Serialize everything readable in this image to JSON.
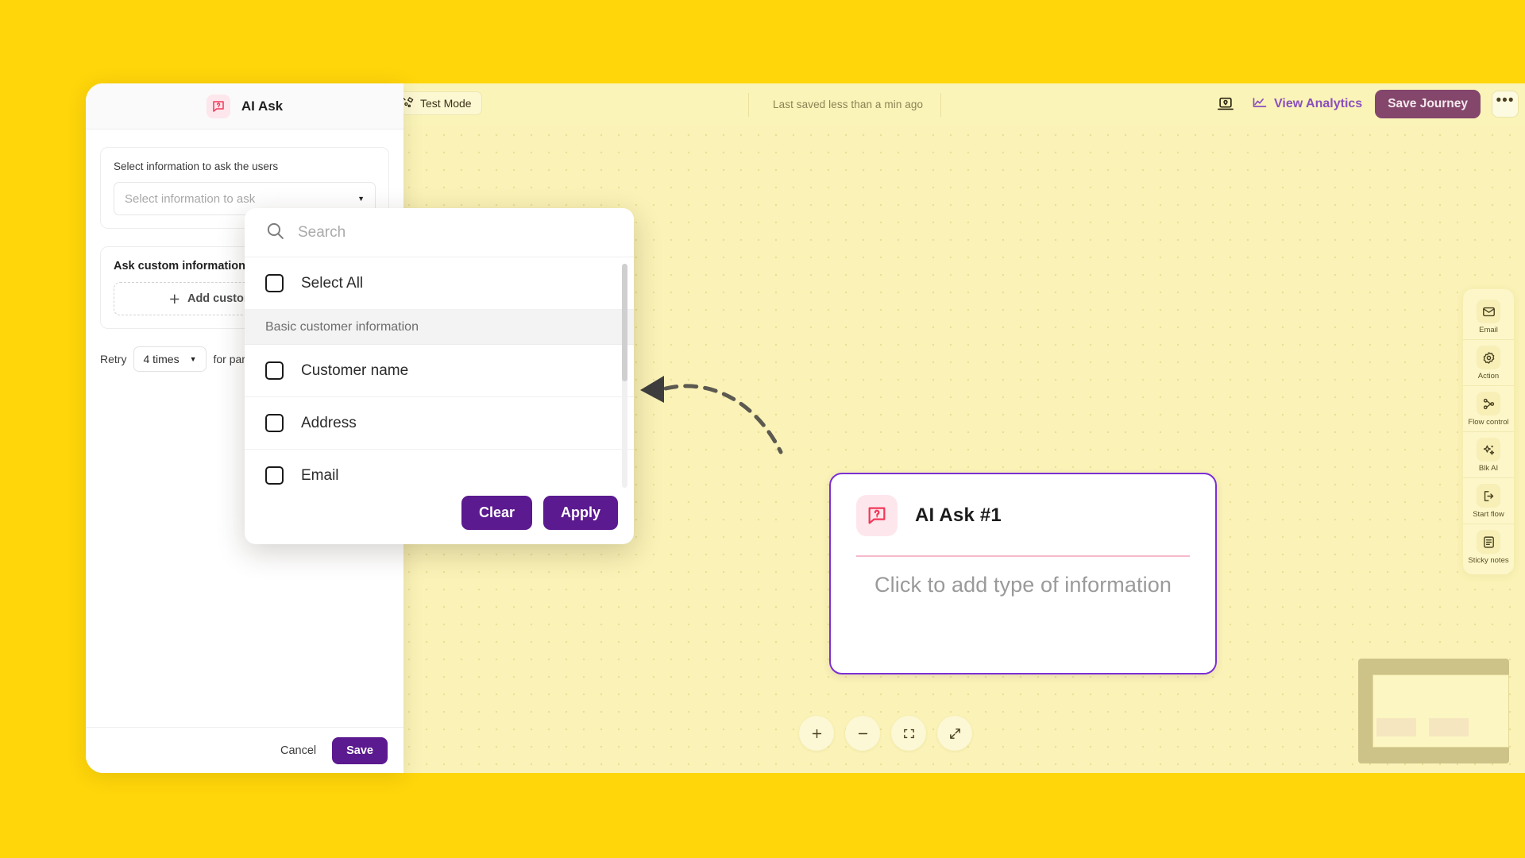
{
  "topbar": {
    "test_mode_label": "Test Mode",
    "test_mode_icon": "test-flask-icon",
    "saved_status": "Last saved less than a min ago",
    "laptop_icon": "laptop-preview-icon",
    "analytics_icon": "line-chart-icon",
    "analytics_label": "View Analytics",
    "save_journey_label": "Save Journey",
    "more_label": "•••",
    "accent_purple": "#8B4FBF",
    "save_journey_bg": "#84476B"
  },
  "panel": {
    "title": "AI Ask",
    "icon": "ai-ask-chat-question-icon",
    "select_card": {
      "label": "Select information to ask the users",
      "placeholder": "Select information to ask",
      "caret_icon": "chevron-down-icon"
    },
    "custom_card": {
      "title": "Ask custom information",
      "add_label": "Add custom information",
      "add_icon": "plus-icon"
    },
    "retry": {
      "prefix": "Retry",
      "value": "4 times",
      "suffix": "for partial",
      "caret_icon": "chevron-down-icon"
    },
    "footer": {
      "cancel_label": "Cancel",
      "save_label": "Save",
      "save_bg": "#5B1A8F"
    }
  },
  "dropdown": {
    "search_placeholder": "Search",
    "search_value": "",
    "search_icon": "search-icon",
    "rows": [
      {
        "kind": "option",
        "label": "Select All",
        "checked": false
      },
      {
        "kind": "group",
        "label": "Basic customer information"
      },
      {
        "kind": "option",
        "label": "Customer name",
        "checked": false
      },
      {
        "kind": "option",
        "label": "Address",
        "checked": false
      },
      {
        "kind": "option",
        "label": "Email",
        "checked": false
      }
    ],
    "clear_label": "Clear",
    "apply_label": "Apply",
    "button_bg": "#5B1A8F"
  },
  "node": {
    "icon": "ai-ask-chat-question-icon",
    "title": "AI Ask #1",
    "placeholder": "Click to add type of information",
    "border_color": "#7B2FD4"
  },
  "tool_rail": {
    "items": [
      {
        "icon": "envelope-icon",
        "label": "Email"
      },
      {
        "icon": "gear-icon",
        "label": "Action"
      },
      {
        "icon": "branch-icon",
        "label": "Flow control"
      },
      {
        "icon": "sparkles-icon",
        "label": "Blk AI"
      },
      {
        "icon": "start-flow-icon",
        "label": "Start flow"
      },
      {
        "icon": "sticky-note-icon",
        "label": "Sticky notes"
      }
    ]
  },
  "zoom_controls": [
    {
      "icon": "plus-icon",
      "label": "+"
    },
    {
      "icon": "minus-icon",
      "label": "−"
    },
    {
      "icon": "fit-view-icon",
      "label": ""
    },
    {
      "icon": "expand-icon",
      "label": ""
    }
  ],
  "canvas": {
    "background": "#FAF2B6",
    "connector_icon": "dashed-arrow-icon"
  }
}
